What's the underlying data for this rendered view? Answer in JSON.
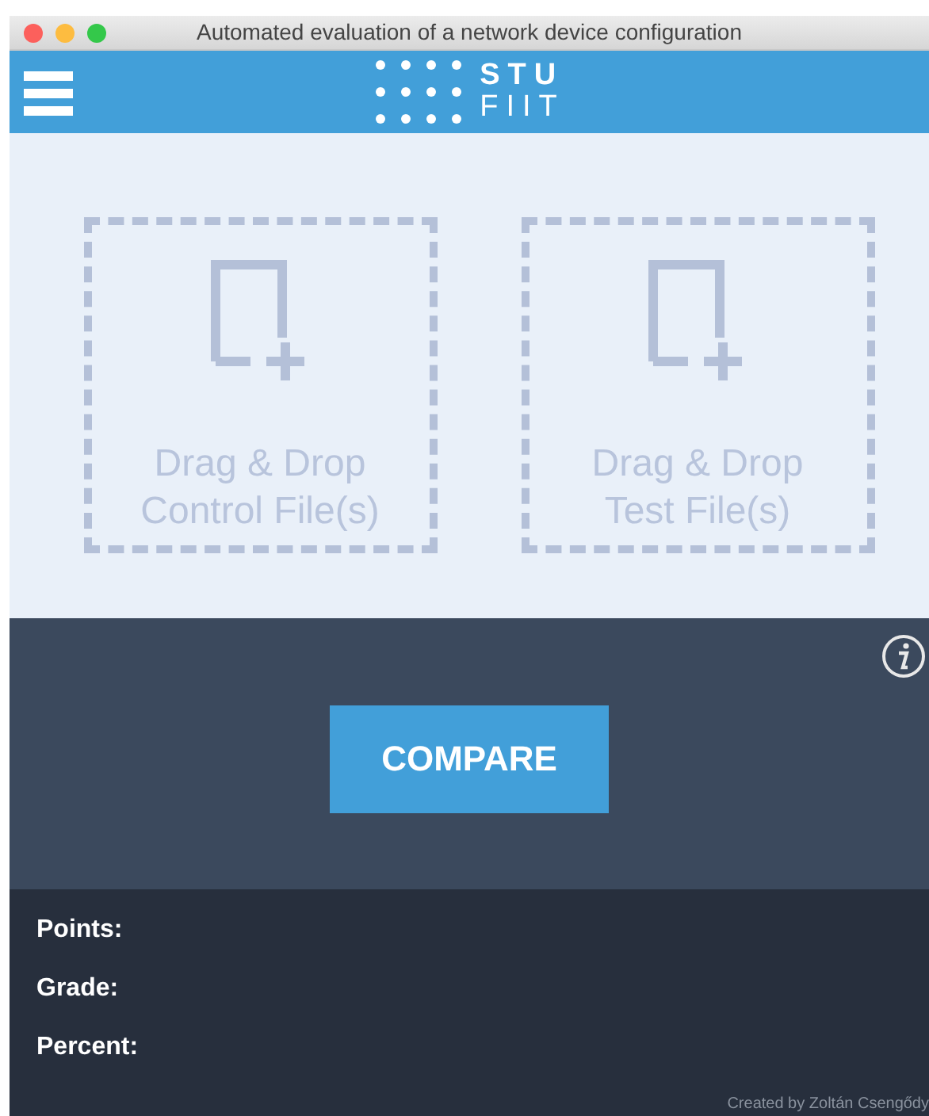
{
  "window": {
    "title": "Automated evaluation of a network device configuration"
  },
  "header": {
    "logo_top": "STU",
    "logo_bottom": "FIIT"
  },
  "drop_zones": [
    {
      "lines": [
        "Drag & Drop",
        "Control File(s)"
      ]
    },
    {
      "lines": [
        "Drag & Drop",
        "Test File(s)"
      ]
    }
  ],
  "compare_button": "COMPARE",
  "results": [
    "Points:",
    "Grade:",
    "Percent:"
  ],
  "credit": "Created by Zoltán Csengődy"
}
